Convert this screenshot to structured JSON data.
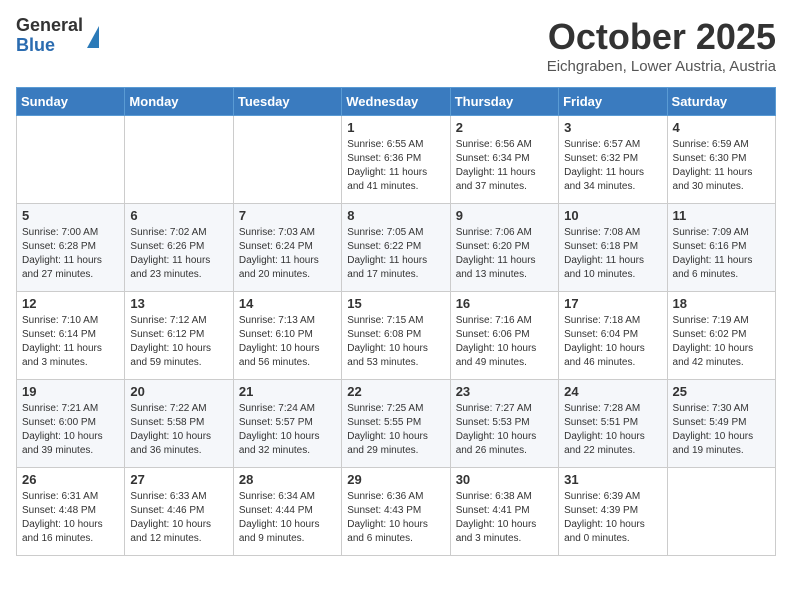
{
  "logo": {
    "general": "General",
    "blue": "Blue"
  },
  "title": "October 2025",
  "location": "Eichgraben, Lower Austria, Austria",
  "weekdays": [
    "Sunday",
    "Monday",
    "Tuesday",
    "Wednesday",
    "Thursday",
    "Friday",
    "Saturday"
  ],
  "weeks": [
    [
      {
        "day": "",
        "info": ""
      },
      {
        "day": "",
        "info": ""
      },
      {
        "day": "",
        "info": ""
      },
      {
        "day": "1",
        "info": "Sunrise: 6:55 AM\nSunset: 6:36 PM\nDaylight: 11 hours\nand 41 minutes."
      },
      {
        "day": "2",
        "info": "Sunrise: 6:56 AM\nSunset: 6:34 PM\nDaylight: 11 hours\nand 37 minutes."
      },
      {
        "day": "3",
        "info": "Sunrise: 6:57 AM\nSunset: 6:32 PM\nDaylight: 11 hours\nand 34 minutes."
      },
      {
        "day": "4",
        "info": "Sunrise: 6:59 AM\nSunset: 6:30 PM\nDaylight: 11 hours\nand 30 minutes."
      }
    ],
    [
      {
        "day": "5",
        "info": "Sunrise: 7:00 AM\nSunset: 6:28 PM\nDaylight: 11 hours\nand 27 minutes."
      },
      {
        "day": "6",
        "info": "Sunrise: 7:02 AM\nSunset: 6:26 PM\nDaylight: 11 hours\nand 23 minutes."
      },
      {
        "day": "7",
        "info": "Sunrise: 7:03 AM\nSunset: 6:24 PM\nDaylight: 11 hours\nand 20 minutes."
      },
      {
        "day": "8",
        "info": "Sunrise: 7:05 AM\nSunset: 6:22 PM\nDaylight: 11 hours\nand 17 minutes."
      },
      {
        "day": "9",
        "info": "Sunrise: 7:06 AM\nSunset: 6:20 PM\nDaylight: 11 hours\nand 13 minutes."
      },
      {
        "day": "10",
        "info": "Sunrise: 7:08 AM\nSunset: 6:18 PM\nDaylight: 11 hours\nand 10 minutes."
      },
      {
        "day": "11",
        "info": "Sunrise: 7:09 AM\nSunset: 6:16 PM\nDaylight: 11 hours\nand 6 minutes."
      }
    ],
    [
      {
        "day": "12",
        "info": "Sunrise: 7:10 AM\nSunset: 6:14 PM\nDaylight: 11 hours\nand 3 minutes."
      },
      {
        "day": "13",
        "info": "Sunrise: 7:12 AM\nSunset: 6:12 PM\nDaylight: 10 hours\nand 59 minutes."
      },
      {
        "day": "14",
        "info": "Sunrise: 7:13 AM\nSunset: 6:10 PM\nDaylight: 10 hours\nand 56 minutes."
      },
      {
        "day": "15",
        "info": "Sunrise: 7:15 AM\nSunset: 6:08 PM\nDaylight: 10 hours\nand 53 minutes."
      },
      {
        "day": "16",
        "info": "Sunrise: 7:16 AM\nSunset: 6:06 PM\nDaylight: 10 hours\nand 49 minutes."
      },
      {
        "day": "17",
        "info": "Sunrise: 7:18 AM\nSunset: 6:04 PM\nDaylight: 10 hours\nand 46 minutes."
      },
      {
        "day": "18",
        "info": "Sunrise: 7:19 AM\nSunset: 6:02 PM\nDaylight: 10 hours\nand 42 minutes."
      }
    ],
    [
      {
        "day": "19",
        "info": "Sunrise: 7:21 AM\nSunset: 6:00 PM\nDaylight: 10 hours\nand 39 minutes."
      },
      {
        "day": "20",
        "info": "Sunrise: 7:22 AM\nSunset: 5:58 PM\nDaylight: 10 hours\nand 36 minutes."
      },
      {
        "day": "21",
        "info": "Sunrise: 7:24 AM\nSunset: 5:57 PM\nDaylight: 10 hours\nand 32 minutes."
      },
      {
        "day": "22",
        "info": "Sunrise: 7:25 AM\nSunset: 5:55 PM\nDaylight: 10 hours\nand 29 minutes."
      },
      {
        "day": "23",
        "info": "Sunrise: 7:27 AM\nSunset: 5:53 PM\nDaylight: 10 hours\nand 26 minutes."
      },
      {
        "day": "24",
        "info": "Sunrise: 7:28 AM\nSunset: 5:51 PM\nDaylight: 10 hours\nand 22 minutes."
      },
      {
        "day": "25",
        "info": "Sunrise: 7:30 AM\nSunset: 5:49 PM\nDaylight: 10 hours\nand 19 minutes."
      }
    ],
    [
      {
        "day": "26",
        "info": "Sunrise: 6:31 AM\nSunset: 4:48 PM\nDaylight: 10 hours\nand 16 minutes."
      },
      {
        "day": "27",
        "info": "Sunrise: 6:33 AM\nSunset: 4:46 PM\nDaylight: 10 hours\nand 12 minutes."
      },
      {
        "day": "28",
        "info": "Sunrise: 6:34 AM\nSunset: 4:44 PM\nDaylight: 10 hours\nand 9 minutes."
      },
      {
        "day": "29",
        "info": "Sunrise: 6:36 AM\nSunset: 4:43 PM\nDaylight: 10 hours\nand 6 minutes."
      },
      {
        "day": "30",
        "info": "Sunrise: 6:38 AM\nSunset: 4:41 PM\nDaylight: 10 hours\nand 3 minutes."
      },
      {
        "day": "31",
        "info": "Sunrise: 6:39 AM\nSunset: 4:39 PM\nDaylight: 10 hours\nand 0 minutes."
      },
      {
        "day": "",
        "info": ""
      }
    ]
  ]
}
